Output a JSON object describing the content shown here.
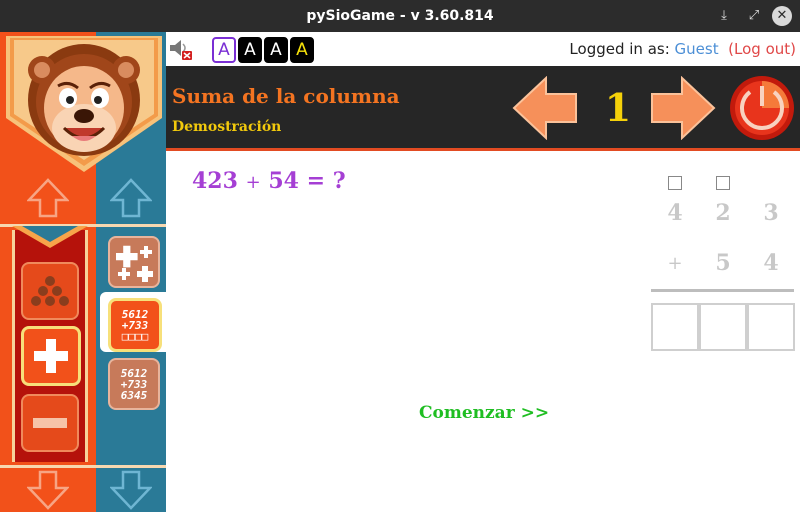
{
  "window": {
    "title": "pySioGame - v 3.60.814"
  },
  "topbar": {
    "font_sizes": [
      "A",
      "A",
      "A",
      "A"
    ],
    "logged_in_label": "Logged in as:",
    "user": "Guest",
    "logout": "(Log out)"
  },
  "header": {
    "title": "Suma de la columna",
    "subtitle": "Demostración",
    "level": "1"
  },
  "question": {
    "a": "423",
    "op": "+",
    "b": "54",
    "eq": "=",
    "q": "?"
  },
  "worksheet": {
    "top_row": [
      "4",
      "2",
      "3"
    ],
    "bottom_row": [
      "+",
      "5",
      "4"
    ]
  },
  "start_label": "Comenzar >>",
  "game_buttons": {
    "addition_icon_rows": [
      "5612",
      "+733",
      "□□□□"
    ],
    "column_icon_rows": [
      "5612",
      "+733",
      "6345"
    ]
  },
  "colors": {
    "orange": "#f2511a",
    "teal": "#2a7a97",
    "dark": "#262626",
    "title": "#f47421",
    "subtitle": "#f2c90c",
    "question": "#a53fd4",
    "start": "#1fbe22"
  }
}
